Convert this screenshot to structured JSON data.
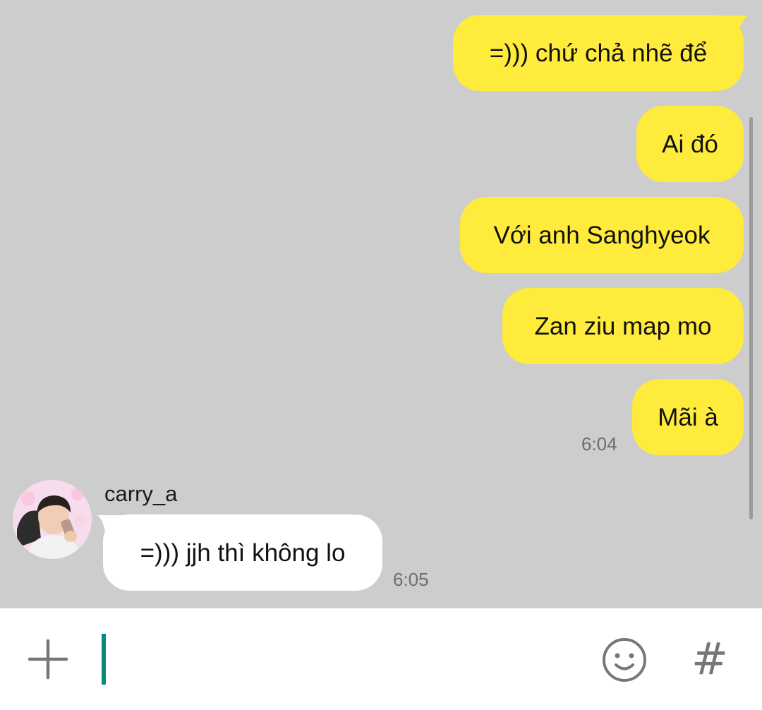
{
  "messages": {
    "outgoing": [
      {
        "text": "=))) chứ chả nhẽ để"
      },
      {
        "text": "Ai đó"
      },
      {
        "text": "Với anh Sanghyeok"
      },
      {
        "text": "Zan ziu map mo"
      },
      {
        "text": "Mãi à"
      }
    ],
    "outgoing_time": "6:04",
    "incoming": {
      "sender": "carry_a",
      "text": "=))) jjh thì không lo",
      "time": "6:05"
    }
  },
  "composer": {
    "value": "",
    "plus_icon": "plus-icon",
    "emoji_icon": "smiley-icon",
    "hash_icon": "hashtag-icon",
    "hash_glyph": "#",
    "caret_color": "#0b8a79"
  },
  "colors": {
    "chat_background": "#cdcdcd",
    "outgoing_bubble": "#ffeb3b",
    "incoming_bubble": "#ffffff"
  }
}
